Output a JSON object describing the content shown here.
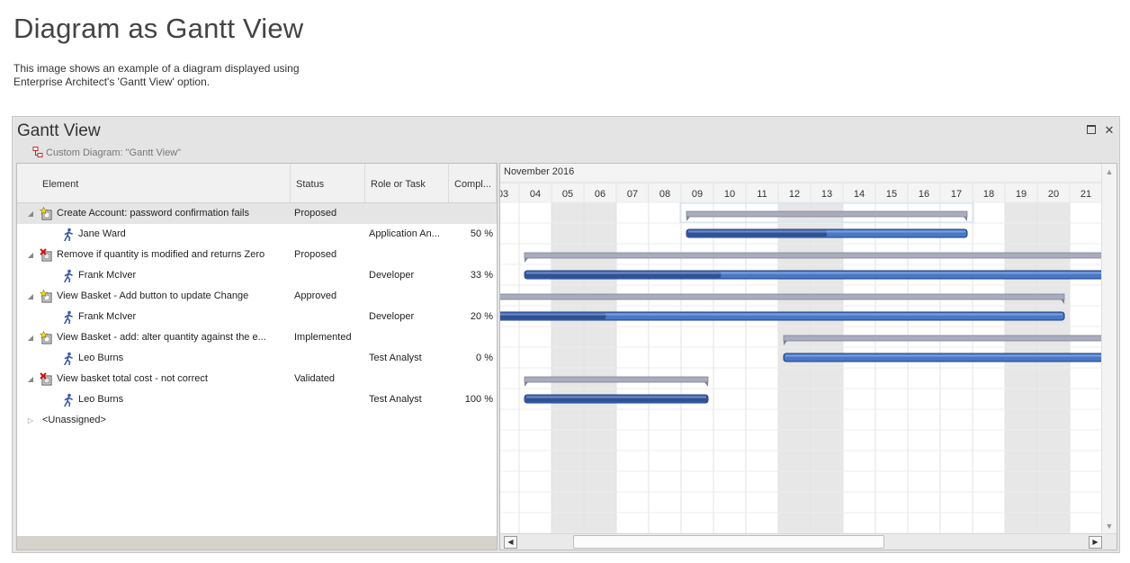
{
  "page": {
    "title": "Diagram as Gantt View",
    "description": "This image shows an example of a diagram displayed using Enterprise Architect's 'Gantt View' option."
  },
  "window": {
    "title": "Gantt View",
    "subtitle": "Custom Diagram: \"Gantt View\"",
    "maximize_icon": "maximize-icon",
    "close_label": "✕"
  },
  "grid": {
    "columns": [
      "Element",
      "Status",
      "Role or Task",
      "Compl..."
    ],
    "rows": [
      {
        "kind": "element",
        "icon": "requirement-icon",
        "element": "Create Account: password confirmation fails",
        "status": "Proposed",
        "role": "",
        "pct": ""
      },
      {
        "kind": "resource",
        "icon": "actor-icon",
        "element": "Jane Ward",
        "status": "",
        "role": "Application An...",
        "pct": "50 %"
      },
      {
        "kind": "element",
        "icon": "issue-icon",
        "element": "Remove if quantity is modified and returns Zero",
        "status": "Proposed",
        "role": "",
        "pct": ""
      },
      {
        "kind": "resource",
        "icon": "actor-icon",
        "element": "Frank McIver",
        "status": "",
        "role": "Developer",
        "pct": "33 %"
      },
      {
        "kind": "element",
        "icon": "requirement-icon",
        "element": "View Basket - Add button to update Change",
        "status": "Approved",
        "role": "",
        "pct": ""
      },
      {
        "kind": "resource",
        "icon": "actor-icon",
        "element": "Frank McIver",
        "status": "",
        "role": "Developer",
        "pct": "20 %"
      },
      {
        "kind": "element",
        "icon": "requirement-icon",
        "element": "View Basket - add: alter quantity against the e...",
        "status": "Implemented",
        "role": "",
        "pct": ""
      },
      {
        "kind": "resource",
        "icon": "actor-icon",
        "element": "Leo Burns",
        "status": "",
        "role": "Test Analyst",
        "pct": "0 %"
      },
      {
        "kind": "element",
        "icon": "issue-icon",
        "element": "View basket total cost - not correct",
        "status": "Validated",
        "role": "",
        "pct": ""
      },
      {
        "kind": "resource",
        "icon": "actor-icon",
        "element": "Leo Burns",
        "status": "",
        "role": "Test Analyst",
        "pct": "100 %"
      }
    ],
    "unassigned": "<Unassigned>"
  },
  "gantt": {
    "month": "November 2016",
    "days": [
      "03",
      "04",
      "05",
      "06",
      "07",
      "08",
      "09",
      "10",
      "11",
      "12",
      "13",
      "14",
      "15",
      "16",
      "17",
      "18",
      "19",
      "20",
      "21"
    ],
    "weekend_days": [
      "05",
      "06",
      "12",
      "13",
      "19",
      "20"
    ],
    "colors": {
      "summary": "#a8acbd",
      "bar": "#4a78c8",
      "bar_done": "#2e5296",
      "weekend": "#e7e7e7",
      "grid": "#e3e3e3"
    },
    "tasks": [
      {
        "row": 0,
        "type": "summary",
        "start": "09",
        "end": "17"
      },
      {
        "row": 1,
        "type": "bar",
        "start": "09",
        "end": "17",
        "complete": 0.5
      },
      {
        "row": 2,
        "type": "summary",
        "start": "04",
        "end": "21+"
      },
      {
        "row": 3,
        "type": "bar",
        "start": "04",
        "end": "21+",
        "complete": 0.33
      },
      {
        "row": 4,
        "type": "summary",
        "start": "03-",
        "end": "20"
      },
      {
        "row": 5,
        "type": "bar",
        "start": "03-",
        "end": "20",
        "complete": 0.2
      },
      {
        "row": 6,
        "type": "summary",
        "start": "12",
        "end": "21+"
      },
      {
        "row": 7,
        "type": "bar",
        "start": "12",
        "end": "21+",
        "complete": 0
      },
      {
        "row": 8,
        "type": "summary",
        "start": "04",
        "end": "09"
      },
      {
        "row": 9,
        "type": "bar",
        "start": "04",
        "end": "09",
        "complete": 1
      }
    ]
  }
}
